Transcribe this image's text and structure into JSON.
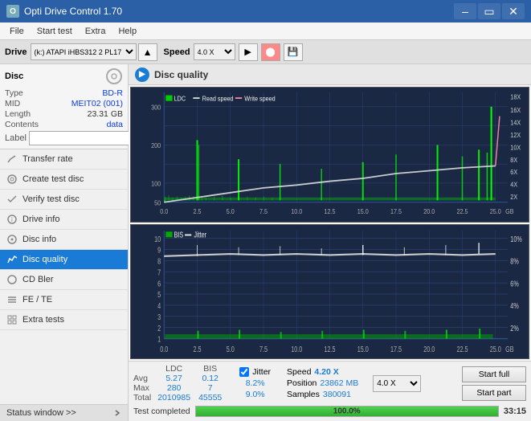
{
  "window": {
    "title": "Opti Drive Control 1.70",
    "controls": [
      "minimize",
      "maximize",
      "close"
    ]
  },
  "menu": {
    "items": [
      "File",
      "Start test",
      "Extra",
      "Help"
    ]
  },
  "topbar": {
    "drive_label": "Drive",
    "drive_value": "(k:) ATAPI iHBS312  2 PL17",
    "speed_label": "Speed",
    "speed_value": "4.0 X"
  },
  "disc_panel": {
    "title": "Disc",
    "rows": [
      {
        "label": "Type",
        "value": "BD-R"
      },
      {
        "label": "MID",
        "value": "MEIT02 (001)"
      },
      {
        "label": "Length",
        "value": "23.31 GB"
      },
      {
        "label": "Contents",
        "value": "data"
      },
      {
        "label": "Label",
        "value": ""
      }
    ]
  },
  "sidebar": {
    "items": [
      {
        "id": "transfer-rate",
        "label": "Transfer rate",
        "icon": "chart-icon"
      },
      {
        "id": "create-test-disc",
        "label": "Create test disc",
        "icon": "disc-icon"
      },
      {
        "id": "verify-test-disc",
        "label": "Verify test disc",
        "icon": "check-icon"
      },
      {
        "id": "drive-info",
        "label": "Drive info",
        "icon": "info-icon"
      },
      {
        "id": "disc-info",
        "label": "Disc info",
        "icon": "disc2-icon"
      },
      {
        "id": "disc-quality",
        "label": "Disc quality",
        "icon": "quality-icon",
        "active": true
      },
      {
        "id": "cd-bler",
        "label": "CD Bler",
        "icon": "cd-icon"
      },
      {
        "id": "fe-te",
        "label": "FE / TE",
        "icon": "fe-icon"
      },
      {
        "id": "extra-tests",
        "label": "Extra tests",
        "icon": "extra-icon"
      }
    ]
  },
  "status_window": {
    "label": "Status window >>",
    "text": "Test completed"
  },
  "disc_quality": {
    "title": "Disc quality",
    "chart1": {
      "legend": [
        "LDC",
        "Read speed",
        "Write speed"
      ],
      "y_axis_left": [
        300,
        200,
        100,
        50
      ],
      "y_axis_right": [
        "18X",
        "16X",
        "14X",
        "12X",
        "10X",
        "8X",
        "6X",
        "4X",
        "2X"
      ],
      "x_axis": [
        0.0,
        2.5,
        5.0,
        7.5,
        10.0,
        12.5,
        15.0,
        17.5,
        20.0,
        22.5,
        25.0
      ]
    },
    "chart2": {
      "legend": [
        "BIS",
        "Jitter"
      ],
      "y_axis_left": [
        10,
        9,
        8,
        7,
        6,
        5,
        4,
        3,
        2,
        1
      ],
      "y_axis_right": [
        "10%",
        "8%",
        "6%",
        "4%",
        "2%"
      ],
      "x_axis": [
        0.0,
        2.5,
        5.0,
        7.5,
        10.0,
        12.5,
        15.0,
        17.5,
        20.0,
        22.5,
        25.0
      ]
    }
  },
  "stats": {
    "columns": [
      "",
      "LDC",
      "BIS",
      "",
      "Jitter",
      "Speed",
      "4.20 X",
      "speed_select",
      "4.0 X"
    ],
    "rows": [
      {
        "label": "Avg",
        "ldc": "5.27",
        "bis": "0.12",
        "jitter": "8.2%"
      },
      {
        "label": "Max",
        "ldc": "280",
        "bis": "7",
        "jitter": "9.0%",
        "pos_label": "Position",
        "pos_value": "23862 MB"
      },
      {
        "label": "Total",
        "ldc": "2010985",
        "bis": "45555",
        "pos_label": "Samples",
        "pos_value": "380091"
      }
    ],
    "jitter_checked": true,
    "speed_label": "Speed",
    "speed_value": "4.20 X",
    "speed_select": "4.0 X",
    "position_label": "Position",
    "position_value": "23862 MB",
    "samples_label": "Samples",
    "samples_value": "380091",
    "start_full_label": "Start full",
    "start_part_label": "Start part",
    "progress_value": "100.0%",
    "time_value": "33:15",
    "status_text": "Test completed"
  }
}
